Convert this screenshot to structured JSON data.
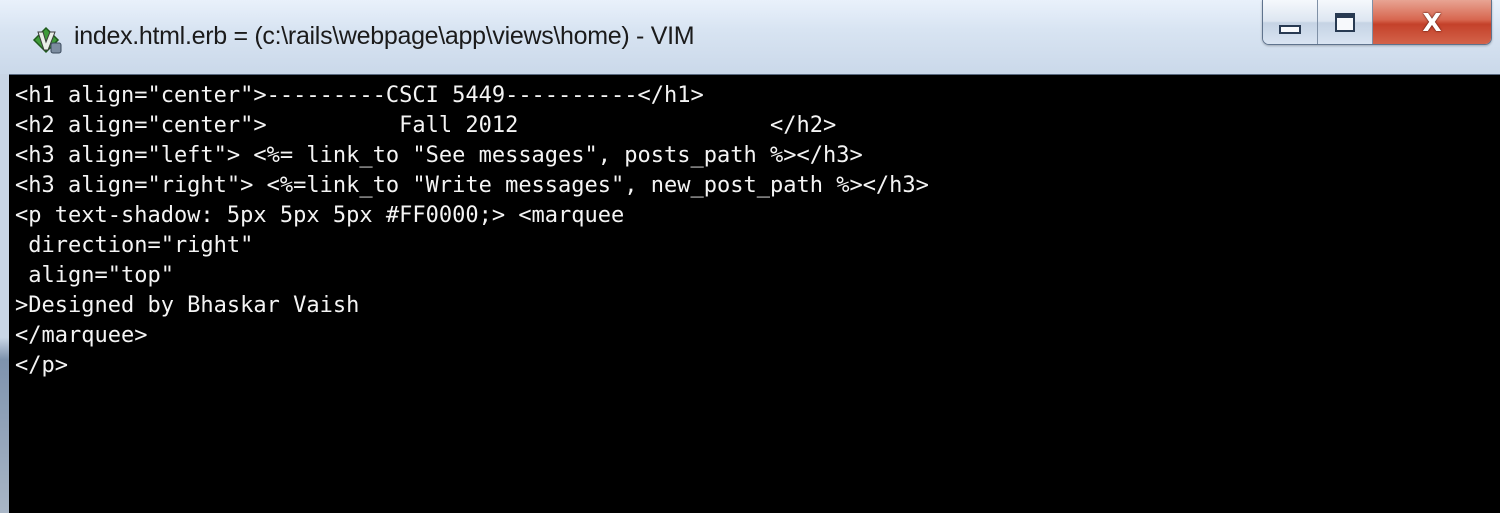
{
  "window": {
    "title": "index.html.erb = (c:\\rails\\webpage\\app\\views\\home) - VIM",
    "app_icon": "vim-icon",
    "buttons": {
      "minimize": "minimize-icon",
      "maximize": "maximize-icon",
      "close_label": "X"
    }
  },
  "editor": {
    "lines": [
      "<h1 align=\"center\">---------CSCI 5449----------</h1>",
      "<h2 align=\"center\">          Fall 2012                   </h2>",
      "<h3 align=\"left\"> <%= link_to \"See messages\", posts_path %></h3>",
      "<h3 align=\"right\"> <%=link_to \"Write messages\", new_post_path %></h3>",
      "<p text-shadow: 5px 5px 5px #FF0000;> <marquee",
      " direction=\"right\"",
      " align=\"top\"",
      ">Designed by Bhaskar Vaish",
      "</marquee>",
      "</p>"
    ]
  },
  "colors": {
    "editor_background": "#000000",
    "text": "#f4f4f4",
    "close_button": "#c9462f"
  }
}
